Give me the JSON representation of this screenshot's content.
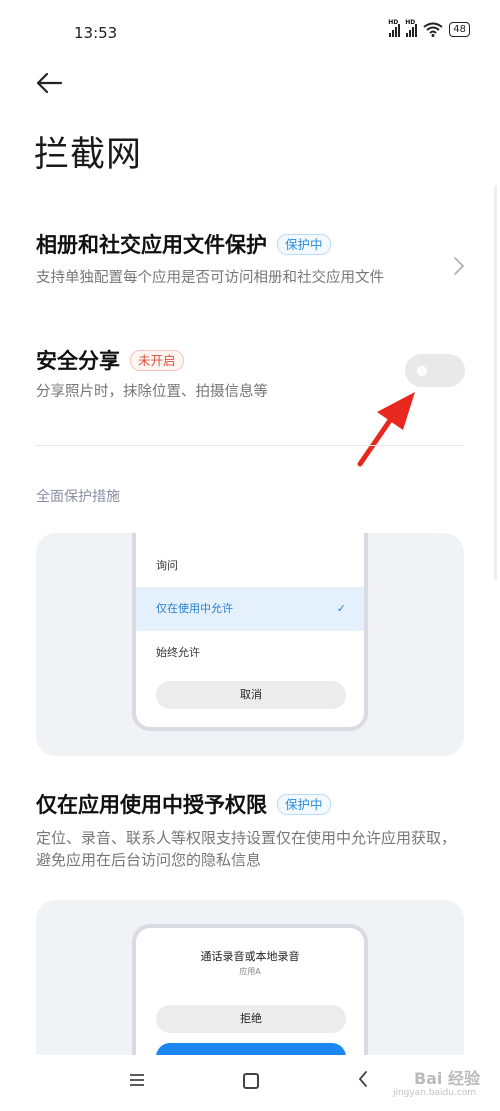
{
  "status_bar": {
    "time": "13:53",
    "signal_label_1": "HD",
    "signal_label_2": "HD",
    "battery": "48"
  },
  "header": {
    "back_icon": "back-arrow-icon",
    "title": "拦截网"
  },
  "album_protection": {
    "title": "相册和社交应用文件保护",
    "badge": "保护中",
    "description": "支持单独配置每个应用是否可访问相册和社交应用文件"
  },
  "secure_share": {
    "title": "安全分享",
    "badge": "未开启",
    "description": "分享照片时，抹除位置、拍摄信息等",
    "enabled": false
  },
  "section": {
    "label": "全面保护措施"
  },
  "permission_card": {
    "options": [
      "询问",
      "仅在使用中允许",
      "始终允许"
    ],
    "selected_index": 1,
    "cancel_label": "取消"
  },
  "while_in_use": {
    "title": "仅在应用使用中授予权限",
    "badge": "保护中",
    "description": "定位、录音、联系人等权限支持设置仅在使用中允许应用获取，避免应用在后台访问您的隐私信息"
  },
  "record_card": {
    "title": "通话录音或本地录音",
    "subtitle": "应用A",
    "deny_label": "拒绝"
  },
  "watermark": {
    "text": "Bai 经验",
    "sub": "jingyan.baidu.com"
  },
  "colors": {
    "accent_blue": "#2a8cdb",
    "badge_red": "#e0503a",
    "arrow_red": "#e8281e"
  }
}
